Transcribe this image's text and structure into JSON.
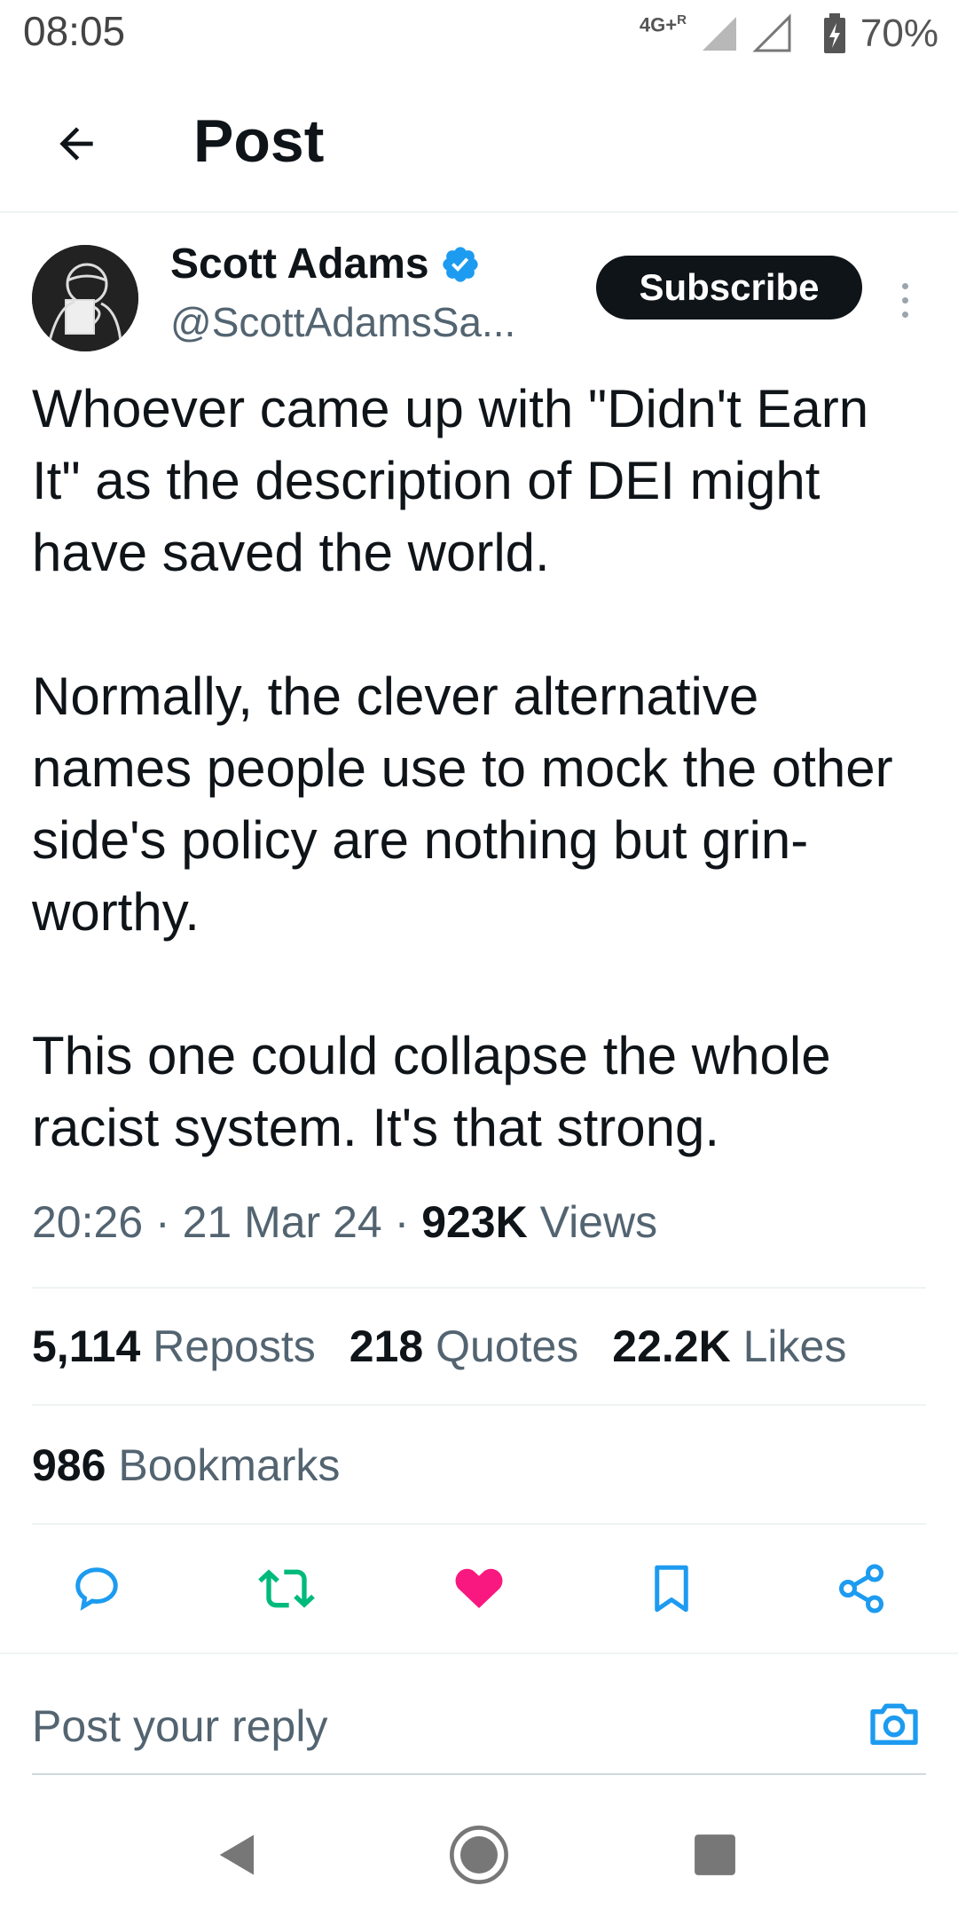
{
  "status_bar": {
    "time": "08:05",
    "network": "4G+",
    "roaming": "R",
    "battery": "70%"
  },
  "header": {
    "title": "Post",
    "back_icon": "arrow-left-icon"
  },
  "author": {
    "name": "Scott Adams",
    "handle": "@ScottAdamsSa...",
    "verified": true,
    "subscribe_label": "Subscribe"
  },
  "post": {
    "paragraphs": [
      "Whoever came up with \"Didn't Earn It\" as the description of DEI might have saved the world.",
      "Normally, the clever alternative names people use to mock the other side's policy are nothing but grin-worthy.",
      "This one could collapse the whole racist system. It's that strong."
    ],
    "time": "20:26",
    "date": "21 Mar 24",
    "views_count": "923K",
    "views_label": "Views",
    "separator": "·"
  },
  "stats": {
    "reposts_count": "5,114",
    "reposts_label": "Reposts",
    "quotes_count": "218",
    "quotes_label": "Quotes",
    "likes_count": "22.2K",
    "likes_label": "Likes",
    "bookmarks_count": "986",
    "bookmarks_label": "Bookmarks"
  },
  "actions": {
    "reply_icon": "reply-icon",
    "repost_icon": "repost-icon",
    "like_icon": "heart-icon",
    "bookmark_icon": "bookmark-icon",
    "share_icon": "share-icon",
    "repost_color": "#00ba7c",
    "like_color": "#f91880"
  },
  "reply_bar": {
    "placeholder": "Post your reply",
    "camera_icon": "camera-icon",
    "accent": "#1d9bf0"
  },
  "nav_bar": {
    "back": "nav-back-icon",
    "home": "nav-home-icon",
    "recents": "nav-recents-icon"
  }
}
